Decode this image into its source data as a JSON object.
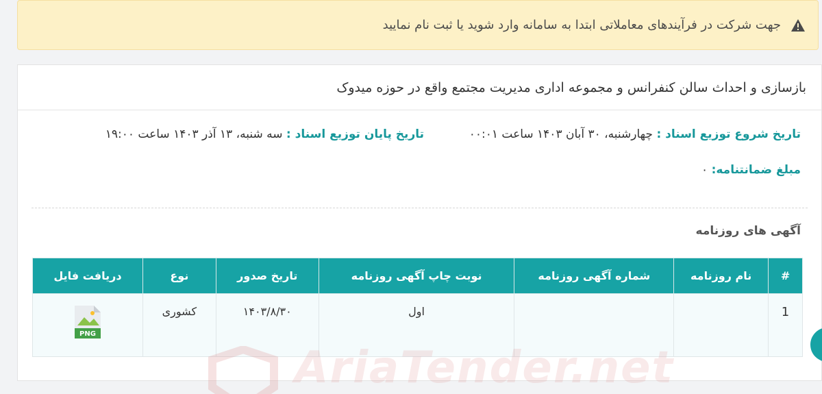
{
  "alert": {
    "icon": "warning-icon",
    "text": "جهت شرکت در فرآیندهای معاملاتی ابتدا به سامانه وارد شوید یا ثبت نام نمایید"
  },
  "tender": {
    "title": "بازسازی و احداث سالن کنفرانس و مجموعه اداری مدیریت مجتمع واقع در حوزه میدوک",
    "start_label": "تاریخ شروع توزیع اسناد :",
    "start_value": "چهارشنبه، ۳۰ آبان ۱۴۰۳ ساعت ۰۰:۰۱",
    "end_label": "تاریخ پایان توزیع اسناد :",
    "end_value": "سه شنبه، ۱۳ آذر ۱۴۰۳ ساعت ۱۹:۰۰",
    "guarantee_label": "مبلغ ضمانتنامه:",
    "guarantee_value": "۰"
  },
  "ads": {
    "section_title": "آگهی های روزنامه",
    "columns": [
      "#",
      "نام روزنامه",
      "شماره آگهی روزنامه",
      "نوبت چاپ آگهی روزنامه",
      "تاریخ صدور",
      "نوع",
      "دریافت فایل"
    ],
    "rows": [
      {
        "index": "1",
        "newspaper": "",
        "ad_number": "",
        "round": "اول",
        "date": "۱۴۰۳/۸/۳۰",
        "type": "کشوری",
        "file_icon": "png-file-icon",
        "file_label": "PNG"
      }
    ]
  },
  "watermark": "AriaTender.net",
  "colors": {
    "accent": "#17a3a5",
    "alert_bg": "#fdf1c7"
  }
}
